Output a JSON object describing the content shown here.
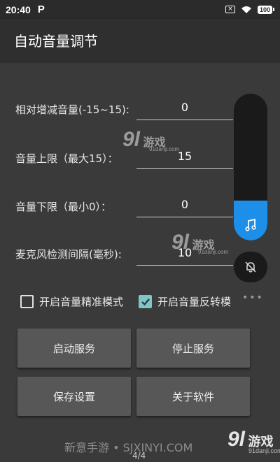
{
  "status_bar": {
    "time": "20:40",
    "app_icon": "P",
    "battery": "100",
    "notification_icon": "close-box-icon",
    "wifi_icon": "wifi-icon"
  },
  "app_bar": {
    "title": "自动音量调节"
  },
  "form": {
    "fields": [
      {
        "label": "相对增减音量(-15~15):",
        "value": "0"
      },
      {
        "label": "音量上限（最大15）：",
        "value": "15"
      },
      {
        "label": "音量下限（最小0）：",
        "value": "0"
      },
      {
        "label": "麦克风检测间隔(毫秒):",
        "value": "10"
      }
    ]
  },
  "options": {
    "precise_mode": {
      "label": "开启音量精准模式",
      "checked": false
    },
    "reverse_mode": {
      "label": "开启音量反转模",
      "checked": true
    }
  },
  "buttons": {
    "start": "启动服务",
    "stop": "停止服务",
    "save": "保存设置",
    "about": "关于软件"
  },
  "volume_panel": {
    "level_fraction": 0.27,
    "active_color": "#1e8fe8",
    "music_icon": "music-note-icon",
    "mute_icon": "bell-off-icon",
    "more_icon": "more-dots-icon"
  },
  "watermarks": [
    {
      "logo": "9l",
      "name": "游戏",
      "site": "91danji.com"
    },
    {
      "logo": "9l",
      "name": "游戏",
      "site": "91danji.com"
    }
  ],
  "footer": {
    "text": "新意手游 • SJXINYI.COM",
    "logo": "9l",
    "logo_name": "游戏",
    "logo_site": "91danji.com",
    "page": "4/4"
  }
}
